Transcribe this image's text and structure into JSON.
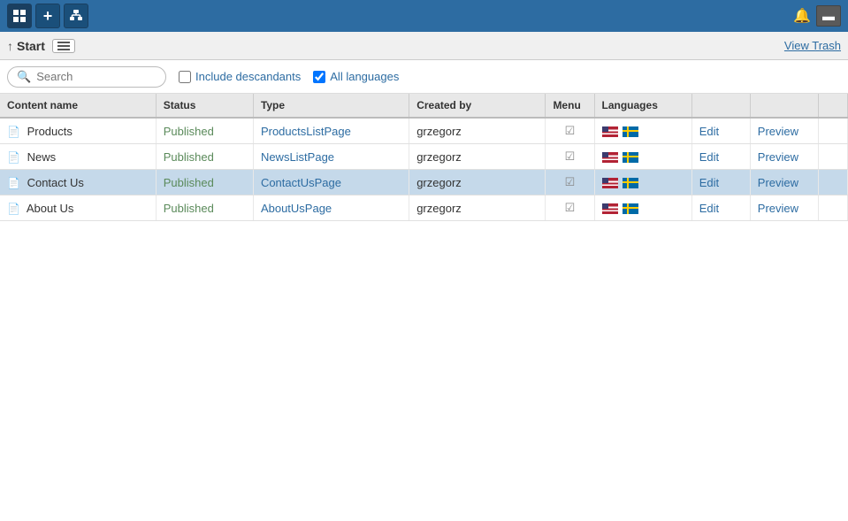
{
  "topToolbar": {
    "buttons": [
      {
        "id": "home",
        "icon": "⊞",
        "label": "Home",
        "active": true
      },
      {
        "id": "add",
        "icon": "+",
        "label": "Add"
      },
      {
        "id": "sitemap",
        "icon": "⊟",
        "label": "Sitemap"
      }
    ],
    "rightButtons": [
      {
        "id": "notification",
        "icon": "🔔",
        "label": "Notifications"
      },
      {
        "id": "window",
        "icon": "⬛",
        "label": "Window"
      }
    ]
  },
  "breadcrumb": {
    "upIcon": "↑",
    "title": "Start",
    "menuIcon": "≡",
    "viewTrash": "View Trash"
  },
  "filter": {
    "searchPlaceholder": "Search",
    "includeDescendants": {
      "label": "Include descandants",
      "checked": false
    },
    "allLanguages": {
      "label": "All languages",
      "checked": true
    }
  },
  "table": {
    "columns": [
      {
        "id": "content-name",
        "label": "Content name"
      },
      {
        "id": "status",
        "label": "Status"
      },
      {
        "id": "type",
        "label": "Type"
      },
      {
        "id": "created-by",
        "label": "Created by"
      },
      {
        "id": "menu",
        "label": "Menu"
      },
      {
        "id": "languages",
        "label": "Languages"
      },
      {
        "id": "edit",
        "label": ""
      },
      {
        "id": "preview",
        "label": ""
      }
    ],
    "rows": [
      {
        "id": 1,
        "name": "Products",
        "status": "Published",
        "type": "ProductsListPage",
        "createdBy": "grzegorz",
        "menu": true,
        "selected": false
      },
      {
        "id": 2,
        "name": "News",
        "status": "Published",
        "type": "NewsListPage",
        "createdBy": "grzegorz",
        "menu": true,
        "selected": false
      },
      {
        "id": 3,
        "name": "Contact Us",
        "status": "Published",
        "type": "ContactUsPage",
        "createdBy": "grzegorz",
        "menu": true,
        "selected": true
      },
      {
        "id": 4,
        "name": "About Us",
        "status": "Published",
        "type": "AboutUsPage",
        "createdBy": "grzegorz",
        "menu": true,
        "selected": false
      }
    ],
    "editLabel": "Edit",
    "previewLabel": "Preview"
  }
}
